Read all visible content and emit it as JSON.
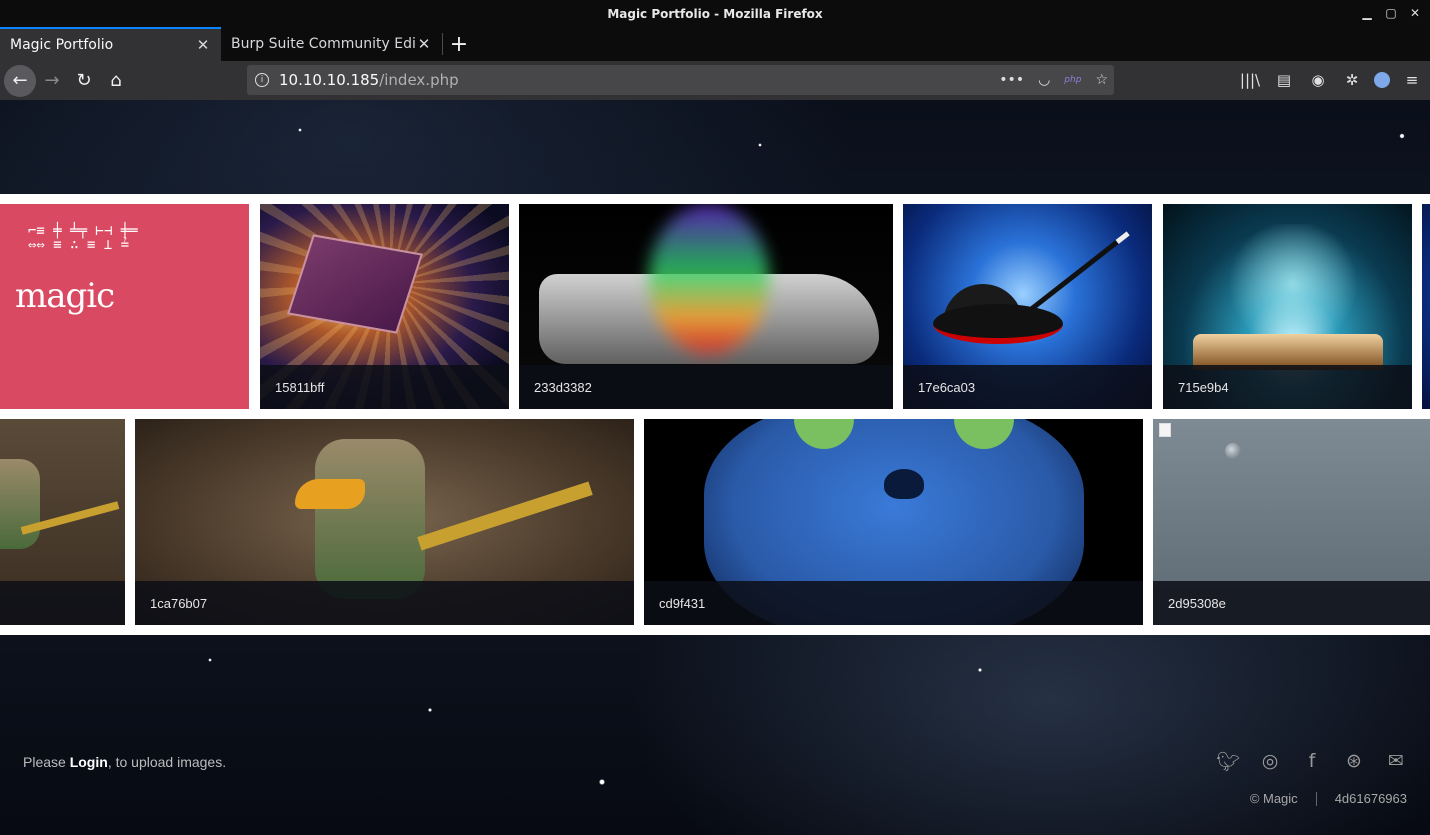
{
  "window": {
    "title": "Magic Portfolio - Mozilla Firefox"
  },
  "tabs": [
    {
      "label": "Magic Portfolio",
      "active": true
    },
    {
      "label": "Burp Suite Community Editi",
      "active": false
    }
  ],
  "nav": {
    "url_host": "10.10.10.185",
    "url_path": "/index.php",
    "php_badge": "php"
  },
  "gallery": {
    "row1": [
      {
        "caption": ""
      },
      {
        "caption": "15811bff"
      },
      {
        "caption": "233d3382"
      },
      {
        "caption": "17e6ca03"
      },
      {
        "caption": "715e9b4"
      }
    ],
    "row2": [
      {
        "caption": ""
      },
      {
        "caption": "1ca76b07"
      },
      {
        "caption": "cd9f431"
      },
      {
        "caption": "2d95308e"
      }
    ],
    "magic_tile_text": "magic"
  },
  "footer": {
    "prefix": "Please ",
    "login_link": "Login",
    "suffix": ", to upload images.",
    "copyright": "© Magic",
    "hash": "4d61676963"
  },
  "colors": {
    "accent": "#0a84ff",
    "magic_tile": "#d94a62"
  }
}
